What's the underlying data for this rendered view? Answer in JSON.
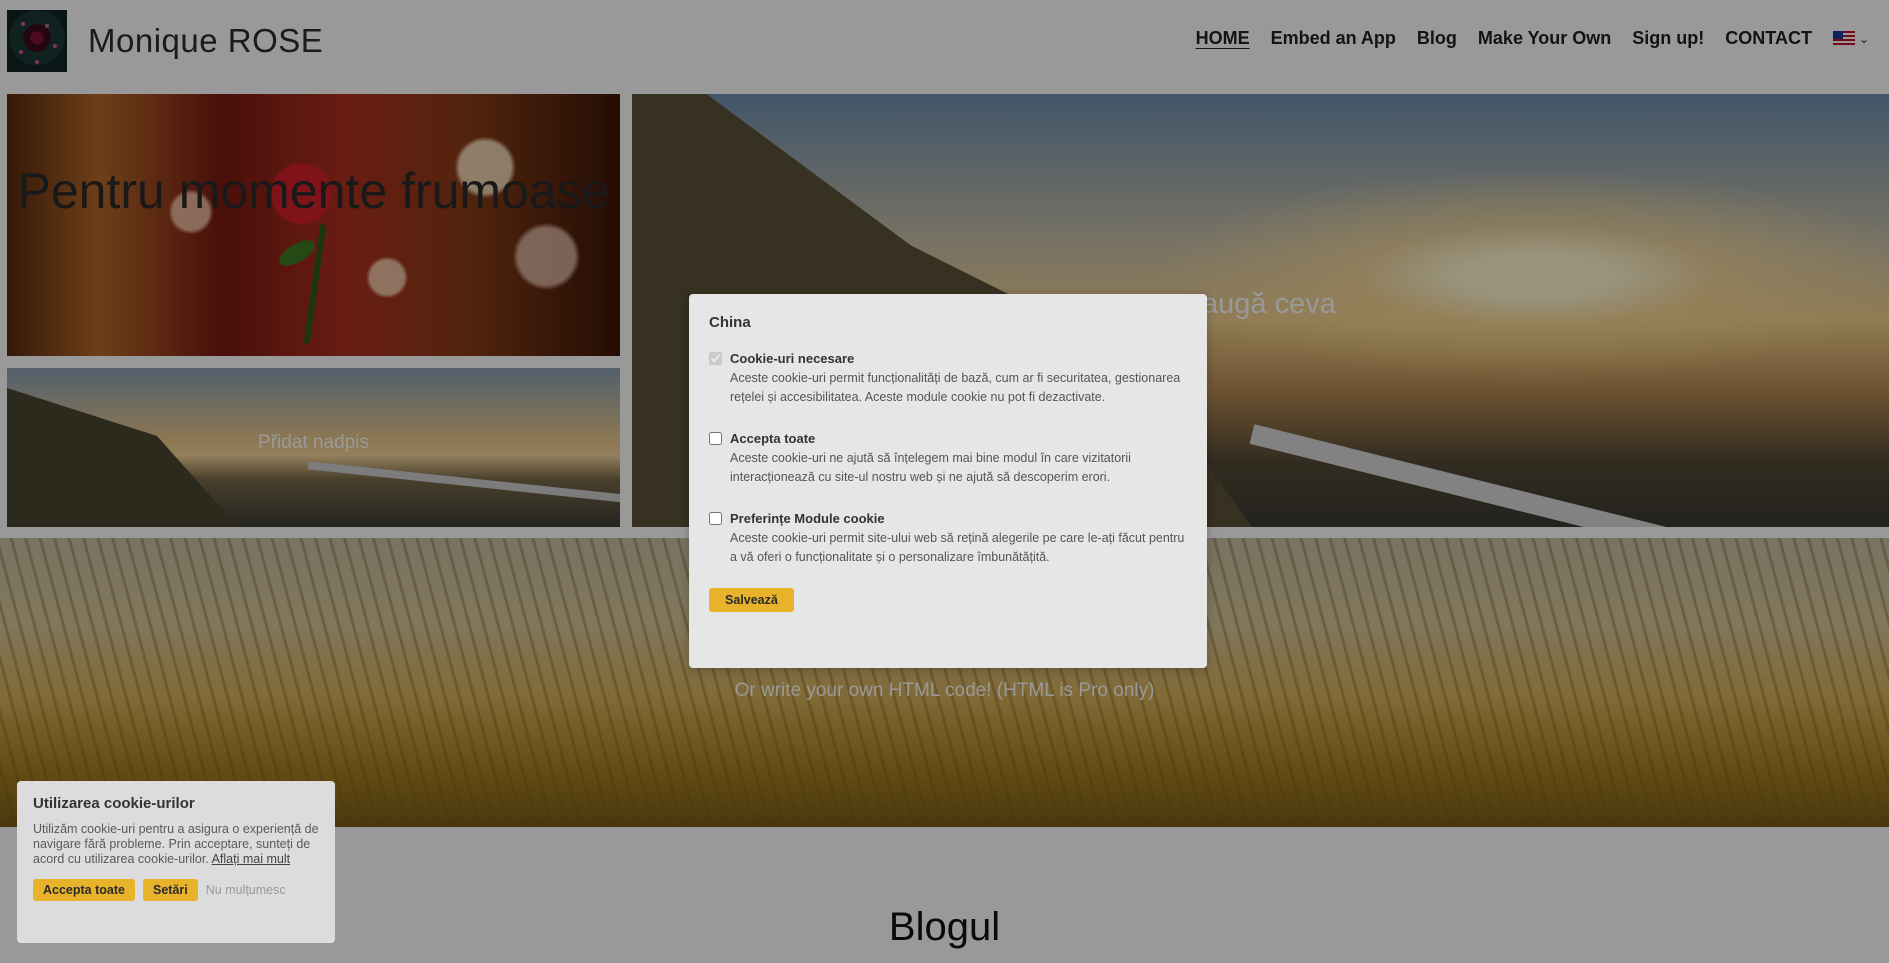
{
  "header": {
    "site_title": "Monique ROSE",
    "nav": [
      {
        "label": "HOME",
        "active": true
      },
      {
        "label": "Embed an App"
      },
      {
        "label": "Blog"
      },
      {
        "label": "Make Your Own"
      },
      {
        "label": "Sign up!"
      },
      {
        "label": "CONTACT"
      }
    ],
    "language_icon": "us-flag-icon"
  },
  "hero": {
    "tile1_text": "Pentru momente frumoase",
    "tile2_text": "Přidat nadpis",
    "tile3_text": "augă ceva",
    "tile4_text": "Or write your own HTML code! (HTML is Pro only)"
  },
  "blog": {
    "title": "Blogul"
  },
  "cookie_bar": {
    "title": "Utilizarea cookie-urilor",
    "text": "Utilizăm cookie-uri pentru a asigura o experiență de navigare fără probleme. Prin acceptare, sunteți de acord cu utilizarea cookie-urilor.",
    "learn_more": "Aflați mai mult",
    "accept_all": "Accepta toate",
    "settings": "Setări",
    "decline": "Nu mulțumesc"
  },
  "modal": {
    "title": "China",
    "options": [
      {
        "name": "Cookie-uri necesare",
        "desc": "Aceste cookie-uri permit funcționalități de bază, cum ar fi securitatea, gestionarea rețelei și accesibilitatea. Aceste module cookie nu pot fi dezactivate.",
        "checked": true,
        "disabled": true
      },
      {
        "name": "Accepta toate",
        "desc": "Aceste cookie-uri ne ajută să înțelegem mai bine modul în care vizitatorii interacționează cu site-ul nostru web și ne ajută să descoperim erori.",
        "checked": false
      },
      {
        "name": "Preferințe Module cookie",
        "desc": "Aceste cookie-uri permit site-ului web să rețină alegerile pe care le-ați făcut pentru a vă oferi o funcționalitate și o personalizare îmbunătățită.",
        "checked": false
      }
    ],
    "save_label": "Salvează"
  },
  "colors": {
    "accent_button": "#e8b32a",
    "overlay": "rgba(0,0,0,0.40)"
  }
}
